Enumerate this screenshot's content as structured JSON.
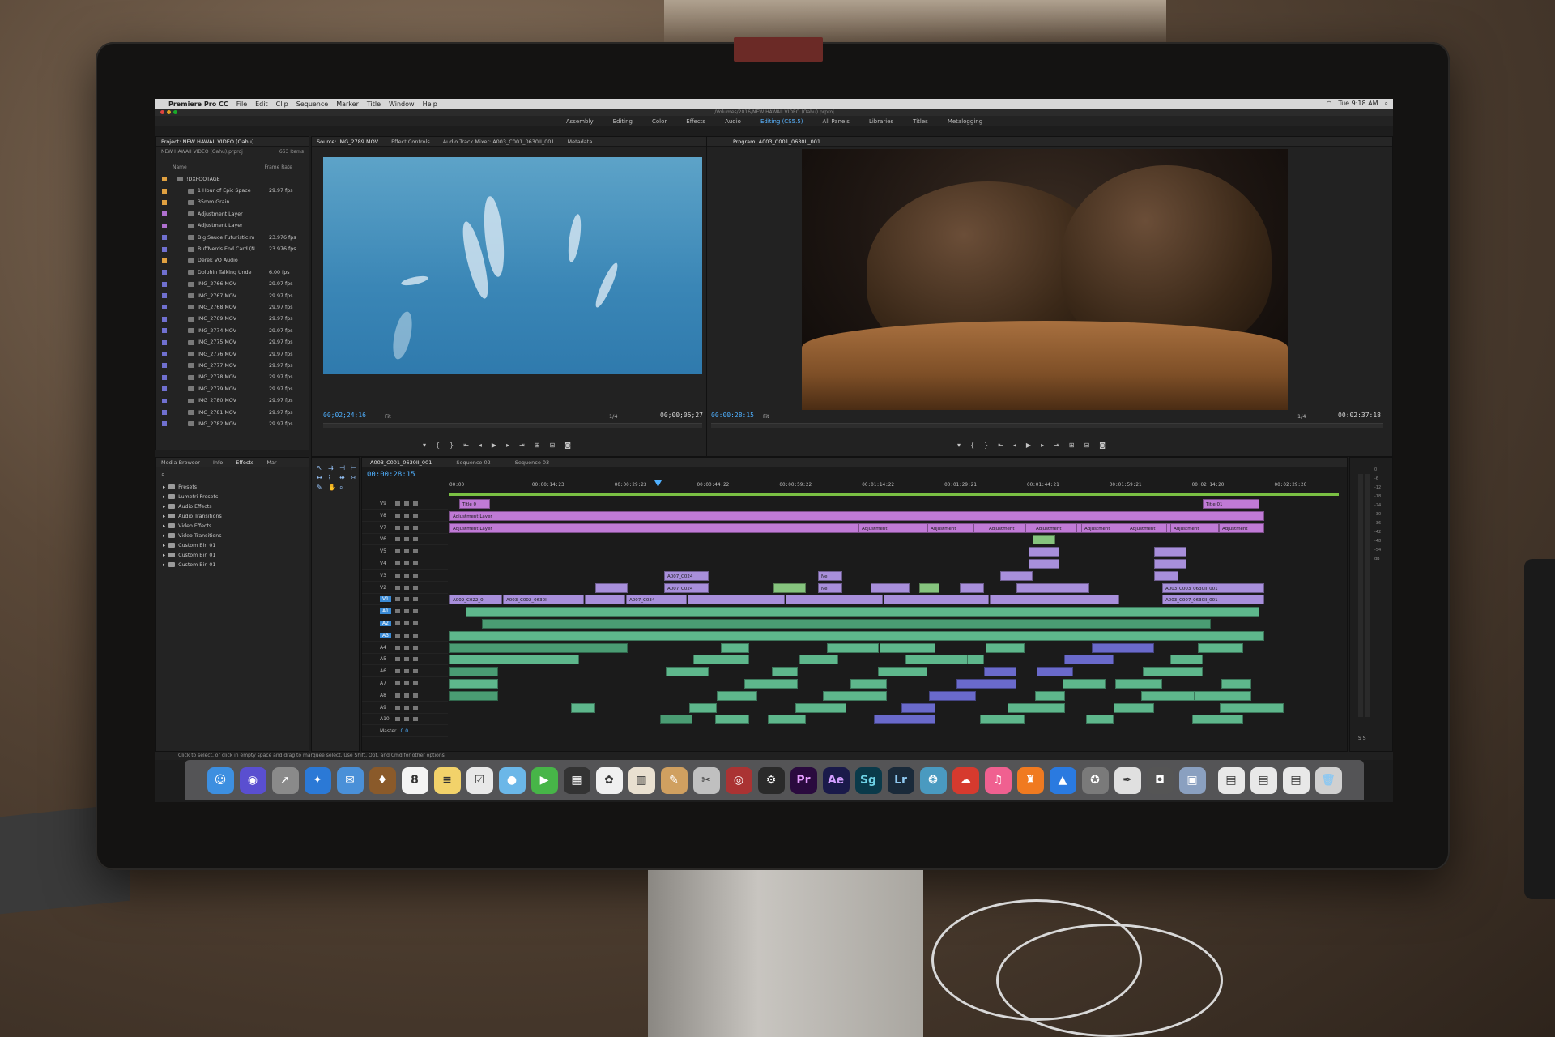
{
  "menubar": {
    "app_name": "Premiere Pro CC",
    "items": [
      "File",
      "Edit",
      "Clip",
      "Sequence",
      "Marker",
      "Title",
      "Window",
      "Help"
    ],
    "clock": "Tue 9:18 AM"
  },
  "window": {
    "path": "/Volumes/2016/NEW HAWAII VIDEO (Oahu).prproj"
  },
  "workspaces": {
    "tabs": [
      "Assembly",
      "Editing",
      "Color",
      "Effects",
      "Audio",
      "Editing (CS5.5)",
      "All Panels",
      "Libraries",
      "Titles",
      "Metalogging"
    ],
    "active": "Editing (CS5.5)"
  },
  "project": {
    "title": "Project: NEW HAWAII VIDEO (Oahu)",
    "file": "NEW HAWAII VIDEO (Oahu).prproj",
    "count": "663 Items",
    "col_name": "Name",
    "col_rate": "Frame Rate",
    "items": [
      {
        "name": "!DXFOOTAGE",
        "fps": "",
        "color": "#e0a040"
      },
      {
        "name": "1 Hour of Epic Space",
        "fps": "29.97 fps",
        "color": "#e0a040"
      },
      {
        "name": "35mm Grain",
        "fps": "",
        "color": "#e0a040"
      },
      {
        "name": "Adjustment Layer",
        "fps": "",
        "color": "#b070d0"
      },
      {
        "name": "Adjustment Layer",
        "fps": "",
        "color": "#b070d0"
      },
      {
        "name": "Big Sauce Futuristic.m",
        "fps": "23.976 fps",
        "color": "#7070d0"
      },
      {
        "name": "BuffNerds End Card (N",
        "fps": "23.976 fps",
        "color": "#7070d0"
      },
      {
        "name": "Derek VO Audio",
        "fps": "",
        "color": "#e0a040"
      },
      {
        "name": "Dolphin Talking Unde",
        "fps": "6.00 fps",
        "color": "#7070d0"
      },
      {
        "name": "IMG_2766.MOV",
        "fps": "29.97 fps",
        "color": "#7070d0"
      },
      {
        "name": "IMG_2767.MOV",
        "fps": "29.97 fps",
        "color": "#7070d0"
      },
      {
        "name": "IMG_2768.MOV",
        "fps": "29.97 fps",
        "color": "#7070d0"
      },
      {
        "name": "IMG_2769.MOV",
        "fps": "29.97 fps",
        "color": "#7070d0"
      },
      {
        "name": "IMG_2774.MOV",
        "fps": "29.97 fps",
        "color": "#7070d0"
      },
      {
        "name": "IMG_2775.MOV",
        "fps": "29.97 fps",
        "color": "#7070d0"
      },
      {
        "name": "IMG_2776.MOV",
        "fps": "29.97 fps",
        "color": "#7070d0"
      },
      {
        "name": "IMG_2777.MOV",
        "fps": "29.97 fps",
        "color": "#7070d0"
      },
      {
        "name": "IMG_2778.MOV",
        "fps": "29.97 fps",
        "color": "#7070d0"
      },
      {
        "name": "IMG_2779.MOV",
        "fps": "29.97 fps",
        "color": "#7070d0"
      },
      {
        "name": "IMG_2780.MOV",
        "fps": "29.97 fps",
        "color": "#7070d0"
      },
      {
        "name": "IMG_2781.MOV",
        "fps": "29.97 fps",
        "color": "#7070d0"
      },
      {
        "name": "IMG_2782.MOV",
        "fps": "29.97 fps",
        "color": "#7070d0"
      }
    ]
  },
  "source": {
    "tabs": [
      "Source: IMG_2789.MOV",
      "Effect Controls",
      "Audio Track Mixer: A003_C001_0630II_001",
      "Metadata"
    ],
    "timecode_in": "00;02;24;16",
    "fit": "Fit",
    "resolution": "1/4",
    "duration": "00;00;05;27"
  },
  "program": {
    "tab": "Program: A003_C001_0630II_001",
    "timecode": "00:00:28:15",
    "fit": "Fit",
    "resolution": "1/4",
    "duration": "00:02:37:18"
  },
  "effects": {
    "tabs": [
      "Media Browser",
      "Info",
      "Effects",
      "Mar"
    ],
    "active": "Effects",
    "items": [
      "Presets",
      "Lumetri Presets",
      "Audio Effects",
      "Audio Transitions",
      "Video Effects",
      "Video Transitions",
      "Custom Bin 01",
      "Custom Bin 01",
      "Custom Bin 01"
    ]
  },
  "timeline": {
    "tabs": [
      "A003_C001_0630II_001",
      "Sequence 02",
      "Sequence 03"
    ],
    "timecode": "00:00:28:15",
    "ruler": [
      "00:00",
      "00:00:14:23",
      "00:00:29:23",
      "00:00:44:22",
      "00:00:59:22",
      "00:01:14:22",
      "00:01:29:21",
      "00:01:44:21",
      "00:01:59:21",
      "00:02:14:20",
      "00:02:29:20"
    ],
    "video_tracks": [
      "V9",
      "V8",
      "V7",
      "V6",
      "V5",
      "V4",
      "V3",
      "V2",
      "V1"
    ],
    "audio_tracks": [
      "A1",
      "A2",
      "A3",
      "A4",
      "A5",
      "A6",
      "A7",
      "A8",
      "A9",
      "A10"
    ],
    "master": "Master",
    "master_value": "0.0",
    "clip_labels": {
      "title": "Title 0",
      "title_end": "Title 01",
      "adj": "Adjustment Layer",
      "adj_short": "Adjustment",
      "a007": "A007_C024",
      "a003": "A003_C002_0630I",
      "a009": "A009_C022_0",
      "a003b": "A003_C003_0630II_001",
      "a003c": "A003_C007_0630II_001",
      "a007b": "A007_C034",
      "ne": "Ne"
    }
  },
  "meters": {
    "scale": [
      "0",
      "-6",
      "-12",
      "-18",
      "-24",
      "-30",
      "-36",
      "-42",
      "-48",
      "-54",
      "dB"
    ],
    "bottom": "S  S"
  },
  "status": {
    "text": "Click to select, or click in empty space and drag to marquee select. Use Shift, Opt, and Cmd for other options."
  },
  "dock": {
    "apps": [
      {
        "label": "☺",
        "color": "#3d8fe0",
        "name": "finder"
      },
      {
        "label": "◉",
        "color": "#5a4fd0",
        "name": "siri"
      },
      {
        "label": "➚",
        "color": "#8a8a8a",
        "name": "launchpad"
      },
      {
        "label": "✦",
        "color": "#2b79d6",
        "name": "safari"
      },
      {
        "label": "✉",
        "color": "#4a90d8",
        "name": "mail"
      },
      {
        "label": "♦",
        "color": "#8a5a2a",
        "name": "contacts"
      },
      {
        "label": "8",
        "color": "#f4f4f4",
        "name": "calendar"
      },
      {
        "label": "≡",
        "color": "#f2d26a",
        "name": "notes"
      },
      {
        "label": "☑",
        "color": "#e8e8e8",
        "name": "reminders"
      },
      {
        "label": "●",
        "color": "#6bb7e8",
        "name": "messages"
      },
      {
        "label": "▶",
        "color": "#47b548",
        "name": "facetime"
      },
      {
        "label": "▦",
        "color": "#333",
        "name": "photo-booth"
      },
      {
        "label": "✿",
        "color": "#f0f0f0",
        "name": "photos"
      },
      {
        "label": "▥",
        "color": "#e9e0d0",
        "name": "keynote"
      },
      {
        "label": "✎",
        "color": "#d0a060",
        "name": "preview"
      },
      {
        "label": "✂",
        "color": "#c0c0c0",
        "name": "capture"
      },
      {
        "label": "◎",
        "color": "#a33",
        "name": "dvd"
      },
      {
        "label": "⚙",
        "color": "#2a2a2a",
        "name": "compressor"
      },
      {
        "label": "Pr",
        "color": "#2a0a3e",
        "name": "premiere"
      },
      {
        "label": "Ae",
        "color": "#1a1a4a",
        "name": "after-effects"
      },
      {
        "label": "Sg",
        "color": "#0a3a4a",
        "name": "speedgrade"
      },
      {
        "label": "Lr",
        "color": "#1a2a3a",
        "name": "lightroom"
      },
      {
        "label": "❂",
        "color": "#4a9ac0",
        "name": "creative-cloud-sync"
      },
      {
        "label": "☁",
        "color": "#d63a2e",
        "name": "creative-cloud"
      },
      {
        "label": "♫",
        "color": "#f06090",
        "name": "itunes"
      },
      {
        "label": "♜",
        "color": "#f07a20",
        "name": "ibooks"
      },
      {
        "label": "▲",
        "color": "#2a7ae0",
        "name": "app-store"
      },
      {
        "label": "✪",
        "color": "#7a7a7a",
        "name": "system-preferences"
      },
      {
        "label": "✒",
        "color": "#e0e0e0",
        "name": "textedit"
      },
      {
        "label": "◘",
        "color": "#555",
        "name": "camera"
      },
      {
        "label": "▣",
        "color": "#8aa0c0",
        "name": "screenshot"
      }
    ],
    "docs": [
      {
        "label": "▤",
        "color": "#e8e8e8",
        "name": "document-1"
      },
      {
        "label": "▤",
        "color": "#e8e8e8",
        "name": "document-2"
      },
      {
        "label": "▤",
        "color": "#e8e8e8",
        "name": "document-3"
      },
      {
        "label": "🗑",
        "color": "#d0d0d0",
        "name": "trash"
      }
    ]
  }
}
